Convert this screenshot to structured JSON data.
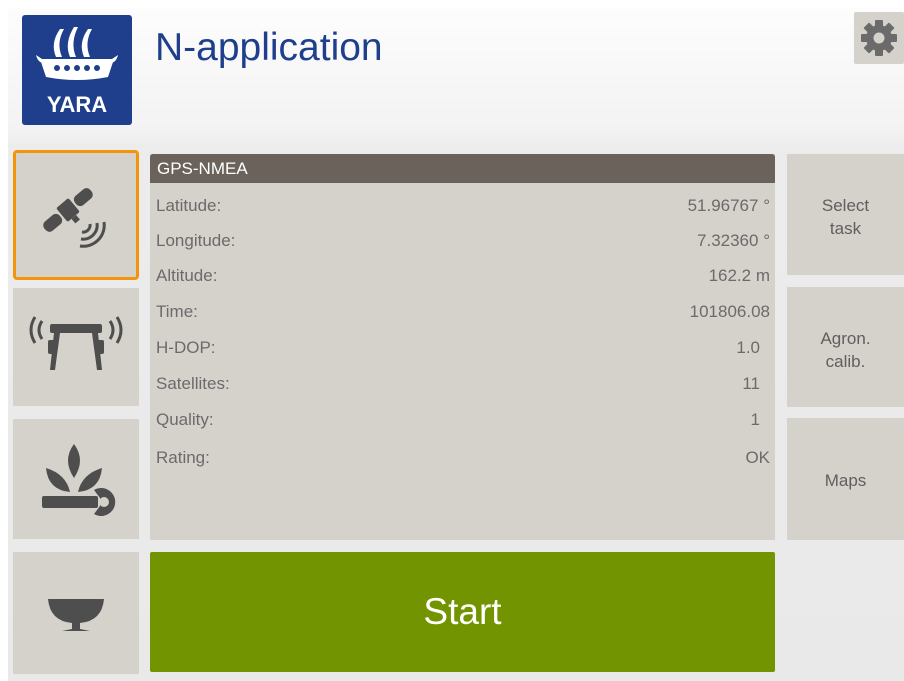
{
  "header": {
    "logo_text": "YARA",
    "title": "N-application"
  },
  "nav": [
    {
      "icon": "satellite-icon",
      "active": true
    },
    {
      "icon": "spreader-icon",
      "active": false
    },
    {
      "icon": "crop-settings-icon",
      "active": false
    },
    {
      "icon": "bowl-icon",
      "active": false
    }
  ],
  "panel": {
    "title": "GPS-NMEA",
    "rows": [
      {
        "label": "Latitude:",
        "value": "51.96767 °"
      },
      {
        "label": "Longitude:",
        "value": "7.32360 °"
      },
      {
        "label": "Altitude:",
        "value": "162.2 m"
      },
      {
        "label": "Time:",
        "value": "101806.08"
      },
      {
        "label": "H-DOP:",
        "value": "1.0"
      },
      {
        "label": "Satellites:",
        "value": "11"
      },
      {
        "label": "Quality:",
        "value": "1"
      },
      {
        "label": "Rating:",
        "value": "OK"
      }
    ]
  },
  "side_buttons": {
    "select_task": [
      "Select",
      "task"
    ],
    "agron_calib": [
      "Agron.",
      "calib."
    ],
    "maps": "Maps"
  },
  "start_label": "Start",
  "colors": {
    "brand_blue": "#1f3f8d",
    "active_border": "#f3950c",
    "start_green": "#719400",
    "panel_header": "#6b635b",
    "panel_bg": "#d5d1cb"
  }
}
